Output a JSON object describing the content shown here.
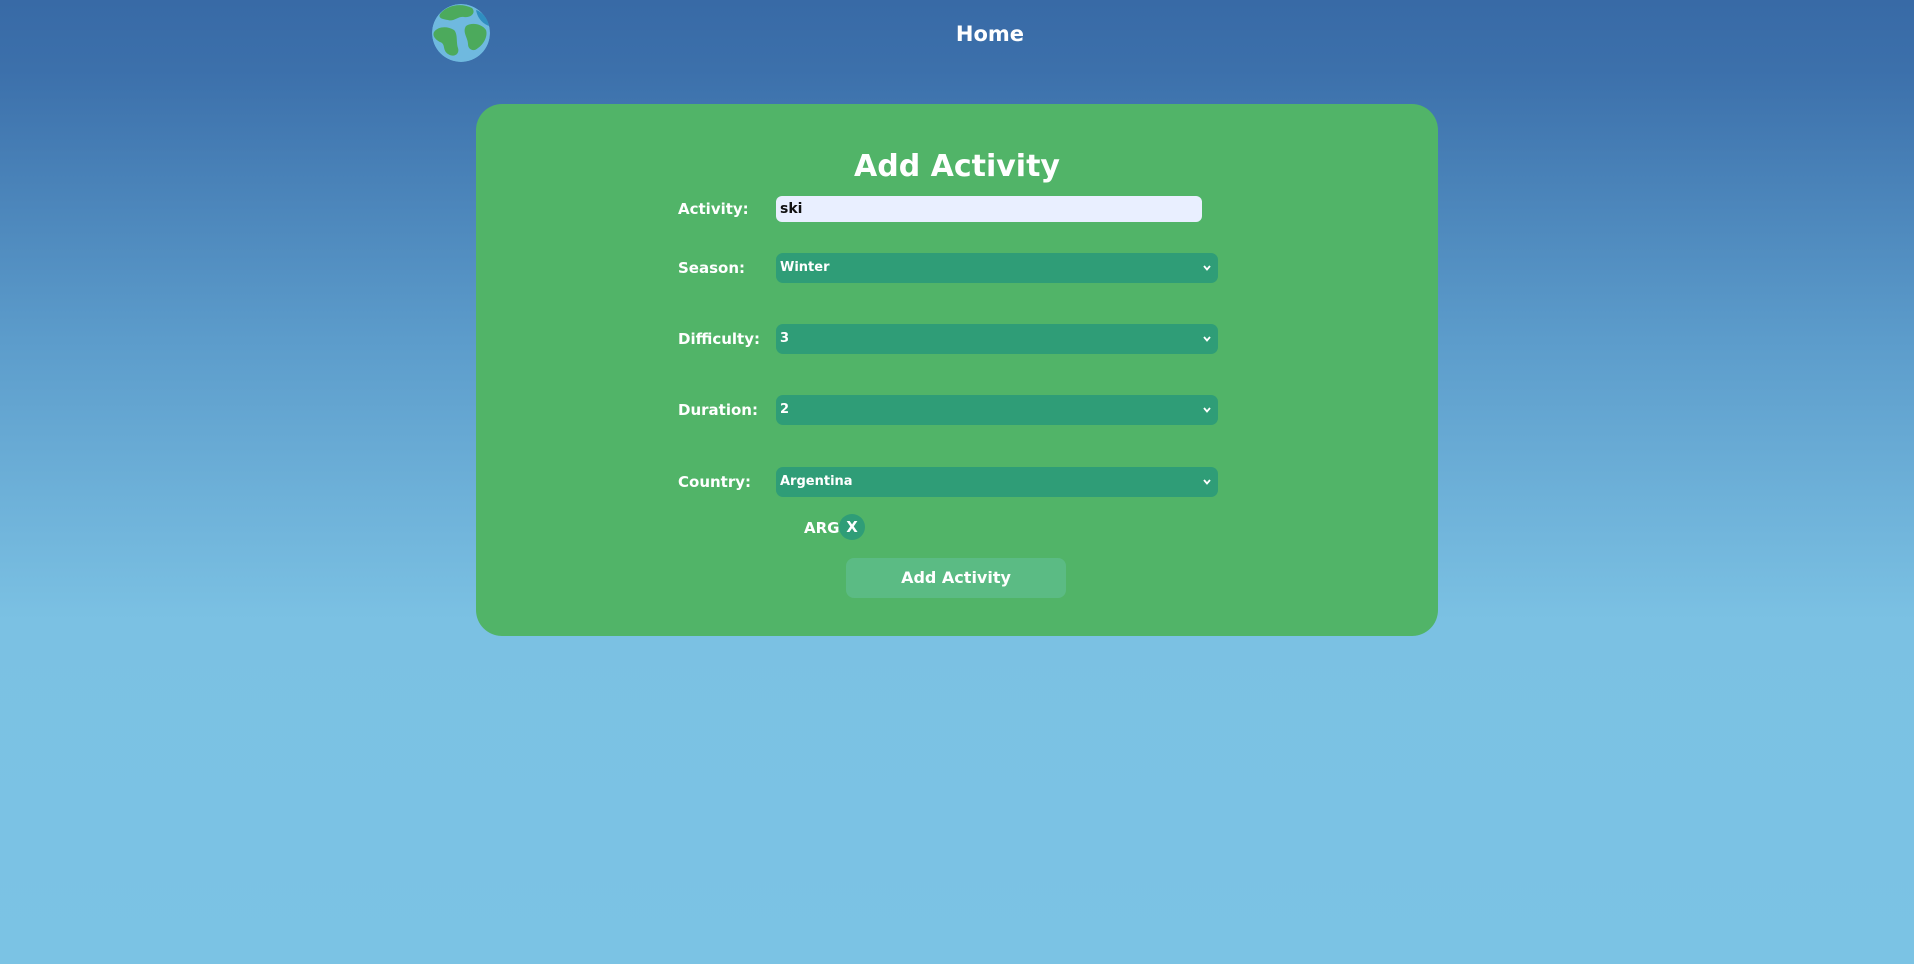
{
  "nav": {
    "logo_icon": "globe-icon",
    "home_label": "Home"
  },
  "form": {
    "title": "Add Activity",
    "activity": {
      "label": "Activity:",
      "value": "ski"
    },
    "season": {
      "label": "Season:",
      "value": "Winter"
    },
    "difficulty": {
      "label": "Difficulty:",
      "value": "3"
    },
    "duration": {
      "label": "Duration:",
      "value": "2"
    },
    "country": {
      "label": "Country:",
      "value": "Argentina"
    },
    "selected_countries": [
      {
        "code": "ARG",
        "remove_label": "X"
      }
    ],
    "submit_label": "Add Activity"
  },
  "colors": {
    "background_top": "#386aa6",
    "background_bottom": "#7bc3e4",
    "card": "#51b468",
    "select": "#2f9d77",
    "input": "#e9efff",
    "button": "#5bbb84"
  }
}
